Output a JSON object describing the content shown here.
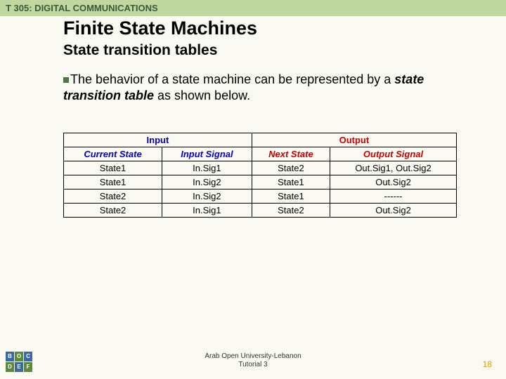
{
  "header": {
    "course": "T 305: DIGITAL COMMUNICATIONS"
  },
  "title": "Finite State Machines",
  "subtitle": "State transition tables",
  "bullet": {
    "pre": "The behavior of a state machine can be represented by a ",
    "emph": "state transition table",
    "post": " as shown below."
  },
  "table": {
    "group_input": "Input",
    "group_output": "Output",
    "col_current_state": "Current State",
    "col_input_signal": "Input Signal",
    "col_next_state": "Next State",
    "col_output_signal": "Output Signal",
    "rows": [
      {
        "cs": "State1",
        "is": "In.Sig1",
        "ns": "State2",
        "os": "Out.Sig1, Out.Sig2"
      },
      {
        "cs": "State1",
        "is": "In.Sig2",
        "ns": "State1",
        "os": "Out.Sig2"
      },
      {
        "cs": "State2",
        "is": "In.Sig2",
        "ns": "State1",
        "os": "------"
      },
      {
        "cs": "State2",
        "is": "In.Sig1",
        "ns": "State2",
        "os": "Out.Sig2"
      }
    ]
  },
  "footer": {
    "line1": "Arab Open University-Lebanon",
    "line2": "Tutorial 3",
    "page": "18"
  },
  "chart_data": {
    "type": "table",
    "title": "State transition table",
    "columns": [
      "Current State",
      "Input Signal",
      "Next State",
      "Output Signal"
    ],
    "column_groups": {
      "Input": [
        "Current State",
        "Input Signal"
      ],
      "Output": [
        "Next State",
        "Output Signal"
      ]
    },
    "rows": [
      [
        "State1",
        "In.Sig1",
        "State2",
        "Out.Sig1, Out.Sig2"
      ],
      [
        "State1",
        "In.Sig2",
        "State1",
        "Out.Sig2"
      ],
      [
        "State2",
        "In.Sig2",
        "State1",
        "------"
      ],
      [
        "State2",
        "In.Sig1",
        "State2",
        "Out.Sig2"
      ]
    ]
  }
}
